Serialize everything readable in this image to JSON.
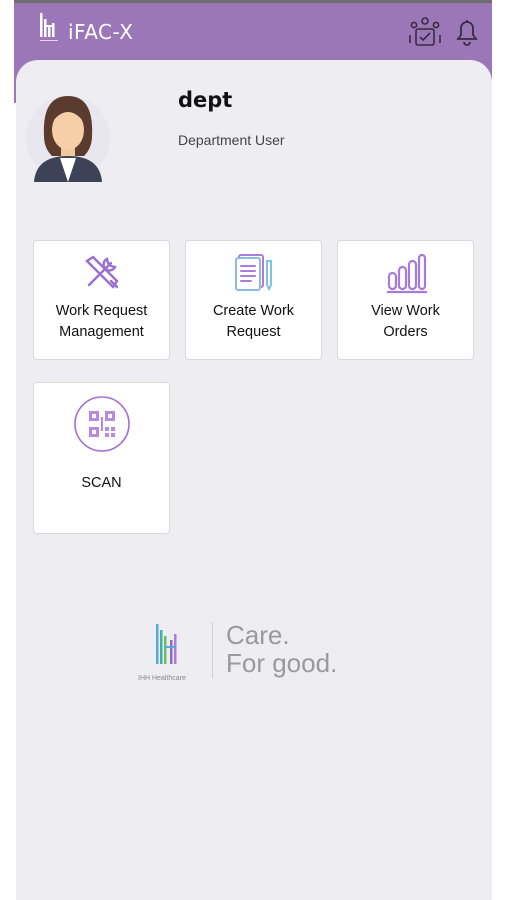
{
  "header": {
    "app_title": "iFAC-X",
    "brand_color": "#9c77b8",
    "icons": [
      "team-icon",
      "bell-icon"
    ]
  },
  "user": {
    "name": "dept",
    "role": "Department User"
  },
  "tiles": [
    {
      "label_line1": "Work Request",
      "label_line2": "Management",
      "icon": "tools-icon"
    },
    {
      "label_line1": "Create Work",
      "label_line2": "Request",
      "icon": "document-icon"
    },
    {
      "label_line1": "View Work",
      "label_line2": "Orders",
      "icon": "bar-chart-icon"
    },
    {
      "label_line1": "SCAN",
      "label_line2": "",
      "icon": "qr-code-icon"
    }
  ],
  "footer": {
    "company": "IHH Healthcare",
    "tagline_line1": "Care.",
    "tagline_line2": "For good."
  }
}
